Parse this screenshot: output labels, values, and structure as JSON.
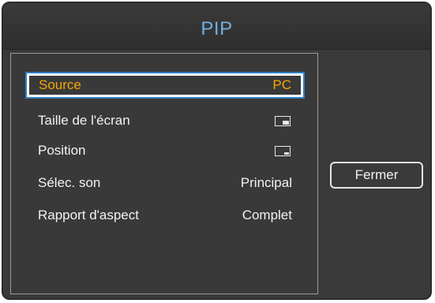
{
  "dialog": {
    "title": "PIP",
    "close_label": "Fermer"
  },
  "menu": {
    "items": [
      {
        "label": "Source",
        "value": "PC",
        "selected": true
      },
      {
        "label": "Taille de l'écran",
        "icon": "pip-size-icon"
      },
      {
        "label": "Position",
        "icon": "pip-position-icon"
      },
      {
        "label": "Sélec. son",
        "value": "Principal"
      },
      {
        "label": "Rapport d'aspect",
        "value": "Complet"
      }
    ]
  },
  "colors": {
    "title": "#76aee0",
    "selected_text": "#f5a800",
    "selection_border": "#2c7fc6",
    "background": "#3a3a3a"
  }
}
